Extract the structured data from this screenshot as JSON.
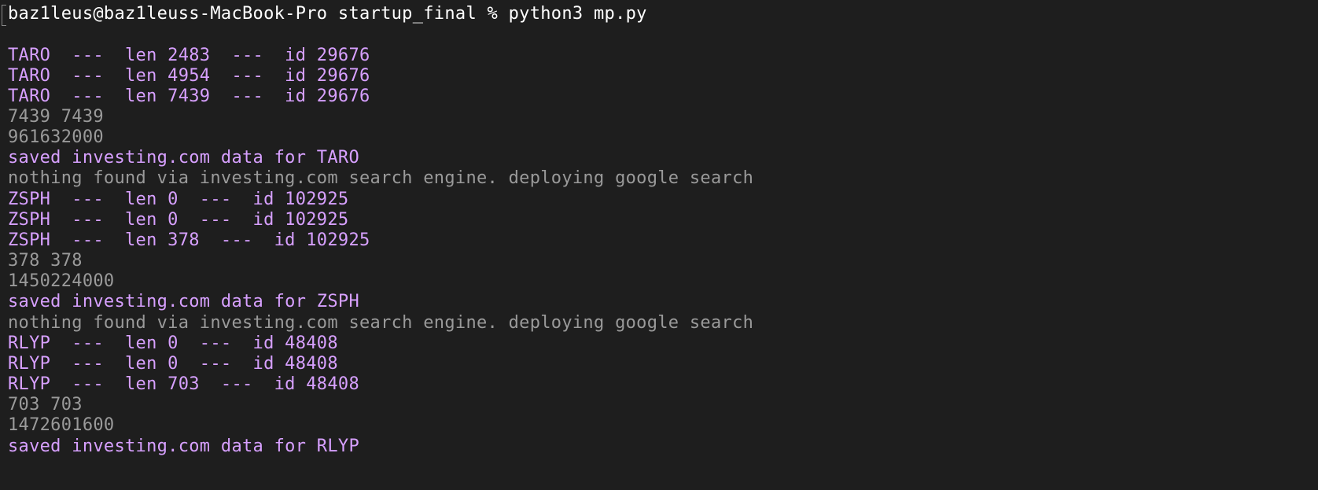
{
  "terminal": {
    "prompt": "baz1leus@baz1leuss-MacBook-Pro startup_final % python3 mp.py",
    "lines": [
      {
        "text": "TARO  ---  len 2483  ---  id 29676",
        "style": "purple"
      },
      {
        "text": "TARO  ---  len 4954  ---  id 29676",
        "style": "purple"
      },
      {
        "text": "TARO  ---  len 7439  ---  id 29676",
        "style": "purple"
      },
      {
        "text": "7439 7439",
        "style": "gray"
      },
      {
        "text": "961632000",
        "style": "gray"
      },
      {
        "text": "saved investing.com data for TARO",
        "style": "purple"
      },
      {
        "text": "nothing found via investing.com search engine. deploying google search",
        "style": "gray"
      },
      {
        "text": "ZSPH  ---  len 0  ---  id 102925",
        "style": "purple"
      },
      {
        "text": "ZSPH  ---  len 0  ---  id 102925",
        "style": "purple"
      },
      {
        "text": "ZSPH  ---  len 378  ---  id 102925",
        "style": "purple"
      },
      {
        "text": "378 378",
        "style": "gray"
      },
      {
        "text": "1450224000",
        "style": "gray"
      },
      {
        "text": "saved investing.com data for ZSPH",
        "style": "purple"
      },
      {
        "text": "nothing found via investing.com search engine. deploying google search",
        "style": "gray"
      },
      {
        "text": "RLYP  ---  len 0  ---  id 48408",
        "style": "purple"
      },
      {
        "text": "RLYP  ---  len 0  ---  id 48408",
        "style": "purple"
      },
      {
        "text": "RLYP  ---  len 703  ---  id 48408",
        "style": "purple"
      },
      {
        "text": "703 703",
        "style": "gray"
      },
      {
        "text": "1472601600",
        "style": "gray"
      },
      {
        "text": "saved investing.com data for RLYP",
        "style": "purple"
      }
    ]
  },
  "colors": {
    "background": "#1e1e1e",
    "prompt": "#ffffff",
    "purple": "#d7a0ff",
    "gray": "#9a9a9a"
  }
}
